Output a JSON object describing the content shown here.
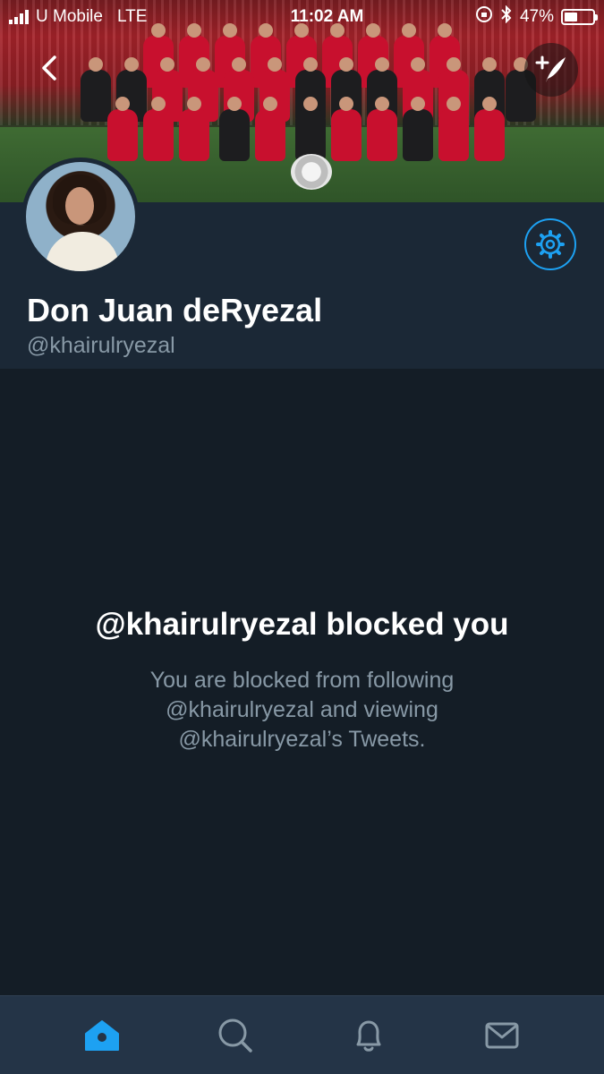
{
  "status_bar": {
    "carrier": "U Mobile",
    "network": "LTE",
    "time": "11:02 AM",
    "battery": "47%",
    "battery_level": 0.47
  },
  "header": {
    "back_icon": "chevron-left-icon",
    "compose_icon": "compose-tweet-icon"
  },
  "profile": {
    "display_name": "Don Juan deRyezal",
    "handle": "@khairulryezal",
    "settings_icon": "gear-icon"
  },
  "blocked": {
    "title": "@khairulryezal blocked you",
    "message": "You are blocked from following @khairulryezal and viewing @khairulryezal’s Tweets."
  },
  "tabbar": {
    "tabs": [
      {
        "name": "home",
        "icon": "home-icon",
        "active": true
      },
      {
        "name": "search",
        "icon": "search-icon",
        "active": false
      },
      {
        "name": "notifications",
        "icon": "bell-icon",
        "active": false
      },
      {
        "name": "messages",
        "icon": "mail-icon",
        "active": false
      }
    ]
  },
  "colors": {
    "accent": "#1da1f2",
    "background": "#141d26",
    "profile_bg": "#1b2836",
    "tabbar_bg": "#243447",
    "secondary_text": "#8899a6"
  }
}
